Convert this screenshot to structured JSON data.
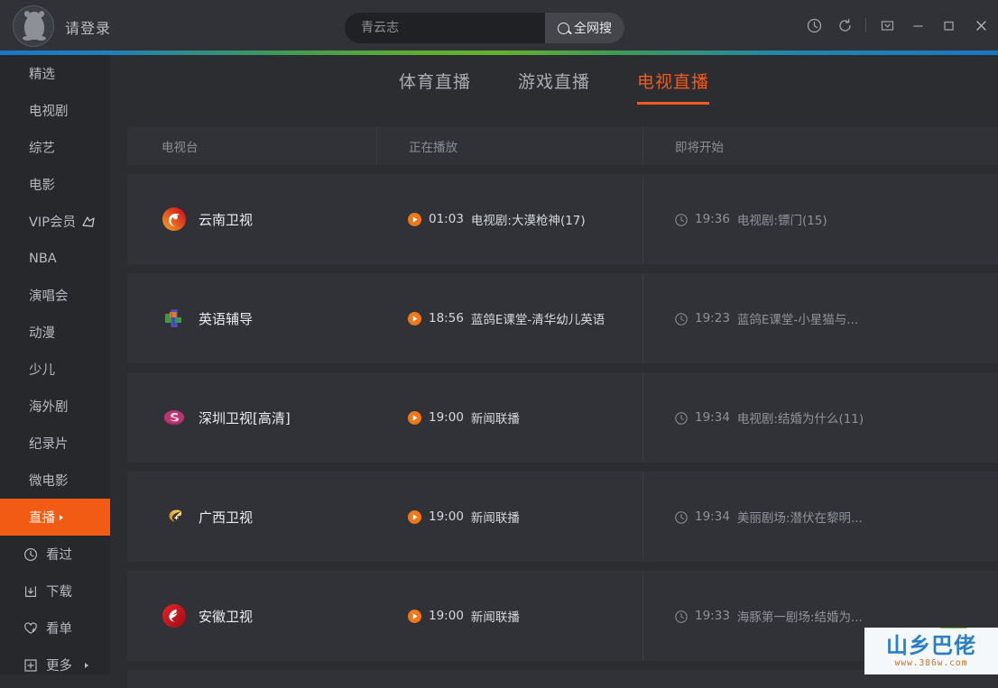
{
  "titlebar": {
    "login_label": "请登录",
    "avatar_icon": "qq-penguin-avatar",
    "search": {
      "placeholder": "青云志",
      "value": ""
    },
    "search_button_label": "全网搜",
    "search_icon": "search-icon",
    "window_icons": [
      {
        "name": "history-icon",
        "label": ""
      },
      {
        "name": "refresh-icon",
        "label": ""
      },
      {
        "name": "mini-window-icon",
        "label": ""
      },
      {
        "name": "minimize-icon",
        "label": ""
      },
      {
        "name": "maximize-icon",
        "label": ""
      },
      {
        "name": "close-icon",
        "label": ""
      }
    ]
  },
  "sidebar": {
    "items": [
      {
        "label": "精选",
        "active": false
      },
      {
        "label": "电视剧",
        "active": false
      },
      {
        "label": "综艺",
        "active": false
      },
      {
        "label": "电影",
        "active": false
      },
      {
        "label": "VIP会员",
        "active": false,
        "badge": "vip-crown-icon"
      },
      {
        "label": "NBA",
        "active": false
      },
      {
        "label": "演唱会",
        "active": false
      },
      {
        "label": "动漫",
        "active": false
      },
      {
        "label": "少儿",
        "active": false
      },
      {
        "label": "海外剧",
        "active": false
      },
      {
        "label": "纪录片",
        "active": false
      },
      {
        "label": "微电影",
        "active": false
      },
      {
        "label": "直播",
        "active": true,
        "caret": true
      }
    ],
    "tools": [
      {
        "label": "看过",
        "icon": "history-clock-icon"
      },
      {
        "label": "下载",
        "icon": "download-icon"
      },
      {
        "label": "看单",
        "icon": "heart-plus-icon"
      },
      {
        "label": "更多",
        "icon": "plus-box-icon",
        "caret": true
      }
    ]
  },
  "main": {
    "tabs": [
      {
        "label": "体育直播",
        "active": false
      },
      {
        "label": "游戏直播",
        "active": false
      },
      {
        "label": "电视直播",
        "active": true
      }
    ],
    "table": {
      "headers": [
        "电视台",
        "正在播放",
        "即将开始"
      ],
      "rows": [
        {
          "channel": "云南卫视",
          "logo": "yunnan-tv-logo",
          "now_time": "01:03",
          "now_title": "电视剧:大漠枪神(17)",
          "next_time": "19:36",
          "next_title": "电视剧:镖门(15)"
        },
        {
          "channel": "英语辅导",
          "logo": "english-tutor-logo",
          "now_time": "18:56",
          "now_title": "蓝鸽E课堂-清华幼儿英语",
          "next_time": "19:23",
          "next_title": "蓝鸽E课堂-小星猫与..."
        },
        {
          "channel": "深圳卫视[高清]",
          "logo": "shenzhen-tv-logo",
          "now_time": "19:00",
          "now_title": "新闻联播",
          "next_time": "19:34",
          "next_title": "电视剧:结婚为什么(11)"
        },
        {
          "channel": "广西卫视",
          "logo": "guangxi-tv-logo",
          "now_time": "19:00",
          "now_title": "新闻联播",
          "next_time": "19:34",
          "next_title": "美丽剧场:潜伏在黎明..."
        },
        {
          "channel": "安徽卫视",
          "logo": "anhui-tv-logo",
          "now_time": "19:00",
          "now_title": "新闻联播",
          "next_time": "19:33",
          "next_title": "海豚第一剧场:结婚为..."
        }
      ]
    }
  },
  "watermark": {
    "logo_text": "山乡巴佬",
    "url": "www.386w.com"
  },
  "colors": {
    "accent": "#f25b14",
    "tab_active": "#f05a1e",
    "panel": "#303238",
    "sidebar_bg": "#26282c",
    "page_bg": "#2b2d30"
  }
}
